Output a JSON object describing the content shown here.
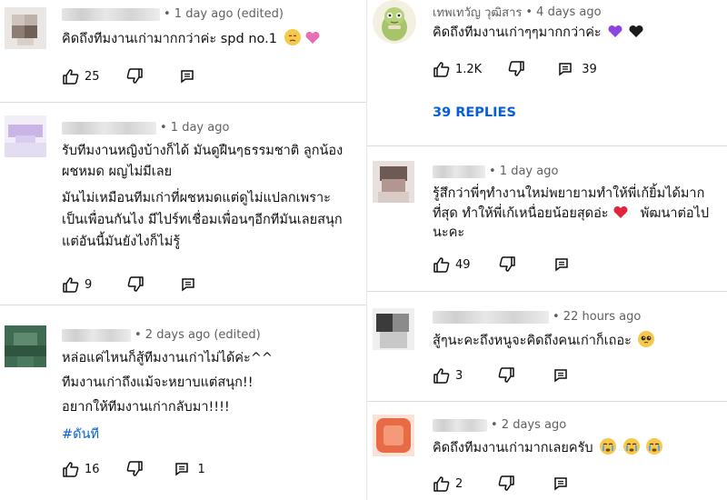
{
  "left": [
    {
      "id": "c1",
      "name": "",
      "time": "• 1 day ago (edited)",
      "lines": [
        "คิดถึงทีมงานเก่ามากกว่าค่ะ spd no.1"
      ],
      "hashtag": "",
      "likes": "25",
      "replies": ""
    },
    {
      "id": "c2",
      "name": "",
      "time": "• 1 day ago",
      "lines": [
        "รับทีมงานหญิงบ้างก็ได้ มันดูฝืนๆธรรมชาติ ลูกน้อง",
        "ผชหมด ผญไม่มีเลย",
        "มันไม่เหมือนทีมเก่าที่ผชหมดแต่ดูไม่แปลกเพราะ",
        "เป็นเพื่อนกันไง มีไปร์ทเชื่อมเพื่อนๆอีกทีมันเลยสนุก",
        "แต่อันนี้มันยังไงก็ไม่รู้"
      ],
      "hashtag": "",
      "likes": "9",
      "replies": ""
    },
    {
      "id": "c3",
      "name": "",
      "time": "• 2 days ago (edited)",
      "lines": [
        "หล่อแค่ไหนก็สู้ทีมงานเก่าไม่ได้ค่ะ^^",
        "ทีมงานเก่าถึงแม้จะหยาบแต่สนุก!!",
        "อยากให้ทีมงานเก่ากลับมา!!!!"
      ],
      "hashtag": "#ดันที",
      "likes": "16",
      "replies": "1"
    }
  ],
  "right": [
    {
      "id": "c4",
      "name": "เทพเทวัญ วุฒิสาร",
      "time": "• 4 days ago",
      "lines": [
        "คิดถึงทีมงานเก่าๆๆมากกว่าค่ะ"
      ],
      "likes": "1.2K",
      "replies": "39",
      "replies_link": "39 REPLIES"
    },
    {
      "id": "c5",
      "name": "",
      "time": "• 1 day ago",
      "lines": [
        "รู้สึกว่าพี่ๆทำงานใหม่พยายามทำให้พี่เก้ยิ้มได้มาก",
        "ที่สุด ทำให้พี่เก้เหนื่อยน้อยสุดอ่ะ",
        "นะคะ"
      ],
      "line2_suffix": "พัฒนาต่อไป",
      "likes": "49",
      "replies": ""
    },
    {
      "id": "c6",
      "name": "",
      "time": "• 22 hours ago",
      "lines": [
        "สู้ๆนะคะถึงหนูจะคิดถึงคนเก่าก็เถอะ"
      ],
      "likes": "3",
      "replies": ""
    },
    {
      "id": "c7",
      "name": "",
      "time": "• 2 days ago",
      "lines": [
        "คิดถึงทีมงานเก่ามากเลยครับ"
      ],
      "likes": "2",
      "replies": ""
    }
  ],
  "icons": {
    "like": "thumbs-up-icon",
    "dislike": "thumbs-down-icon",
    "reply": "reply-icon"
  },
  "colors": {
    "link": "#065fd4",
    "meta": "#606060",
    "text": "#0f0f0f"
  }
}
